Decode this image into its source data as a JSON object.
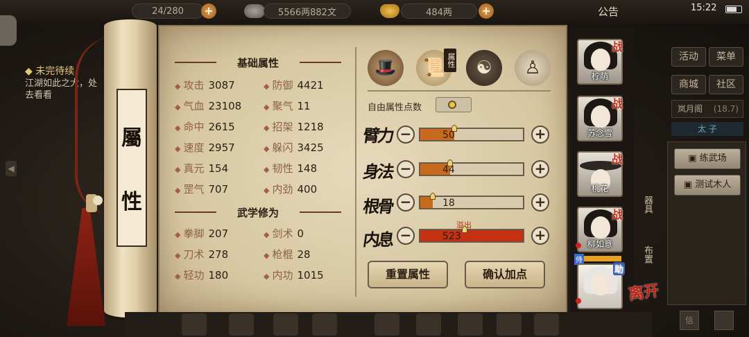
{
  "top_bar": {
    "stamina": "24/280",
    "coins": "5566两882文",
    "gold": "484两",
    "notice": "公告",
    "time": "15:22"
  },
  "left_panel": {
    "quest_title": "未完待续",
    "quest_desc": "江湖如此之大，处去看看"
  },
  "scroll_label": [
    "屬",
    "性"
  ],
  "base_section": {
    "title": "基础属性",
    "stats": [
      {
        "name": "攻击",
        "value": "3087"
      },
      {
        "name": "防御",
        "value": "4421"
      },
      {
        "name": "气血",
        "value": "23108"
      },
      {
        "name": "聚气",
        "value": "11"
      },
      {
        "name": "命中",
        "value": "2615"
      },
      {
        "name": "招架",
        "value": "1218"
      },
      {
        "name": "速度",
        "value": "2957"
      },
      {
        "name": "躲闪",
        "value": "3425"
      },
      {
        "name": "真元",
        "value": "154"
      },
      {
        "name": "韧性",
        "value": "148"
      },
      {
        "name": "罡气",
        "value": "707"
      },
      {
        "name": "内劲",
        "value": "400"
      }
    ]
  },
  "martial_section": {
    "title": "武学修为",
    "stats": [
      {
        "name": "拳脚",
        "value": "207"
      },
      {
        "name": "剑术",
        "value": "0"
      },
      {
        "name": "刀术",
        "value": "278"
      },
      {
        "name": "枪棍",
        "value": "28"
      },
      {
        "name": "轻功",
        "value": "180"
      },
      {
        "name": "内功",
        "value": "1015"
      }
    ]
  },
  "tabs": {
    "attr_badge": "属性"
  },
  "points": {
    "free_label": "自由属性点数",
    "free_value": "0",
    "overflow_label": "溢出",
    "attributes": [
      {
        "label": "臂力",
        "value": "50",
        "fill": 0.33
      },
      {
        "label": "身法",
        "value": "44",
        "fill": 0.29
      },
      {
        "label": "根骨",
        "value": "18",
        "fill": 0.12
      },
      {
        "label": "内息",
        "value": "523",
        "fill": 1.0
      }
    ]
  },
  "buttons": {
    "reset": "重置属性",
    "confirm": "确认加点"
  },
  "roster": [
    {
      "name": "柠萌",
      "badge": "战"
    },
    {
      "name": "苏念雪",
      "badge": "战"
    },
    {
      "name": "桃花",
      "badge": "战"
    },
    {
      "name": "柳如意",
      "badge": "战"
    },
    {
      "name": "",
      "badge": "助"
    }
  ],
  "roster_side": {
    "equip": "器具",
    "layout": "布置",
    "leave": "离开",
    "serve": "侍"
  },
  "right_menu": {
    "activity": "活动",
    "menu": "菜单",
    "mall": "商城",
    "community": "社区",
    "region": "岚月阁",
    "region_sub": "(18.7)",
    "region_tag": "太 子",
    "training": "练武场",
    "dummy": "测试木人",
    "info": "信"
  },
  "colors": {
    "bar_fill": "#c86a1e",
    "bar_overflow": "#c43014",
    "battle_badge": "#c4301a"
  }
}
